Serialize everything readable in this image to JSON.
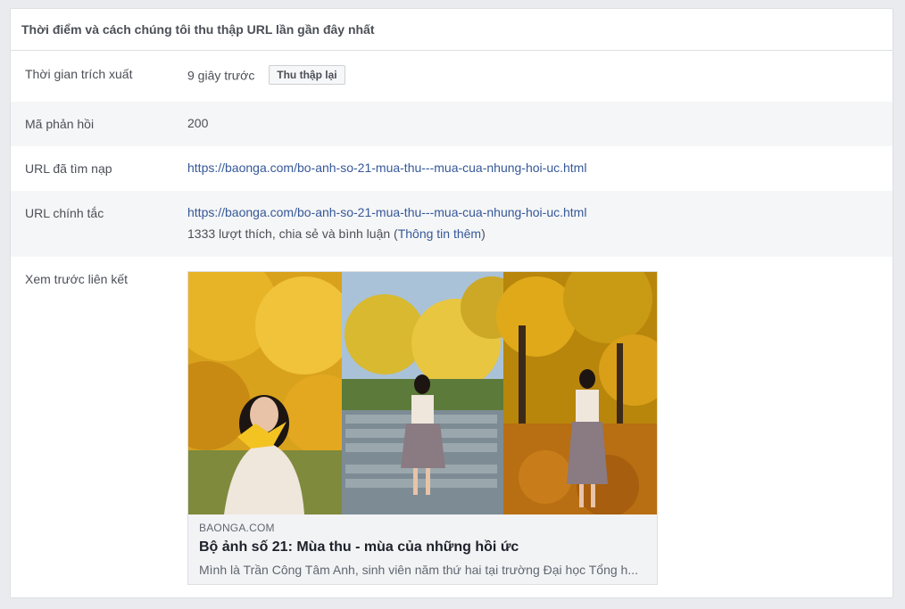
{
  "header": {
    "title": "Thời điểm và cách chúng tôi thu thập URL lần gần đây nhất"
  },
  "rows": {
    "scrape_time": {
      "label": "Thời gian trích xuất",
      "value": "9 giây trước",
      "button": "Thu thập lại"
    },
    "response_code": {
      "label": "Mã phản hồi",
      "value": "200"
    },
    "fetched_url": {
      "label": "URL đã tìm nạp",
      "value": "https://baonga.com/bo-anh-so-21-mua-thu---mua-cua-nhung-hoi-uc.html"
    },
    "canonical_url": {
      "label": "URL chính tắc",
      "value": "https://baonga.com/bo-anh-so-21-mua-thu---mua-cua-nhung-hoi-uc.html",
      "engagement_text": "1333 lượt thích, chia sẻ và bình luận",
      "open_paren": "(",
      "more_info": "Thông tin thêm",
      "close_paren": ")"
    },
    "link_preview": {
      "label": "Xem trước liên kết",
      "domain": "BAONGA.COM",
      "title": "Bộ ảnh số 21: Mùa thu - mùa của những hồi ức",
      "description": "Mình là Trần Công Tâm Anh, sinh viên năm thứ hai tại trường Đại học Tổng h..."
    }
  },
  "colors": {
    "link": "#365899",
    "border": "#dddfe2",
    "alt_row": "#f5f6f7",
    "page_bg": "#e9ebee"
  }
}
